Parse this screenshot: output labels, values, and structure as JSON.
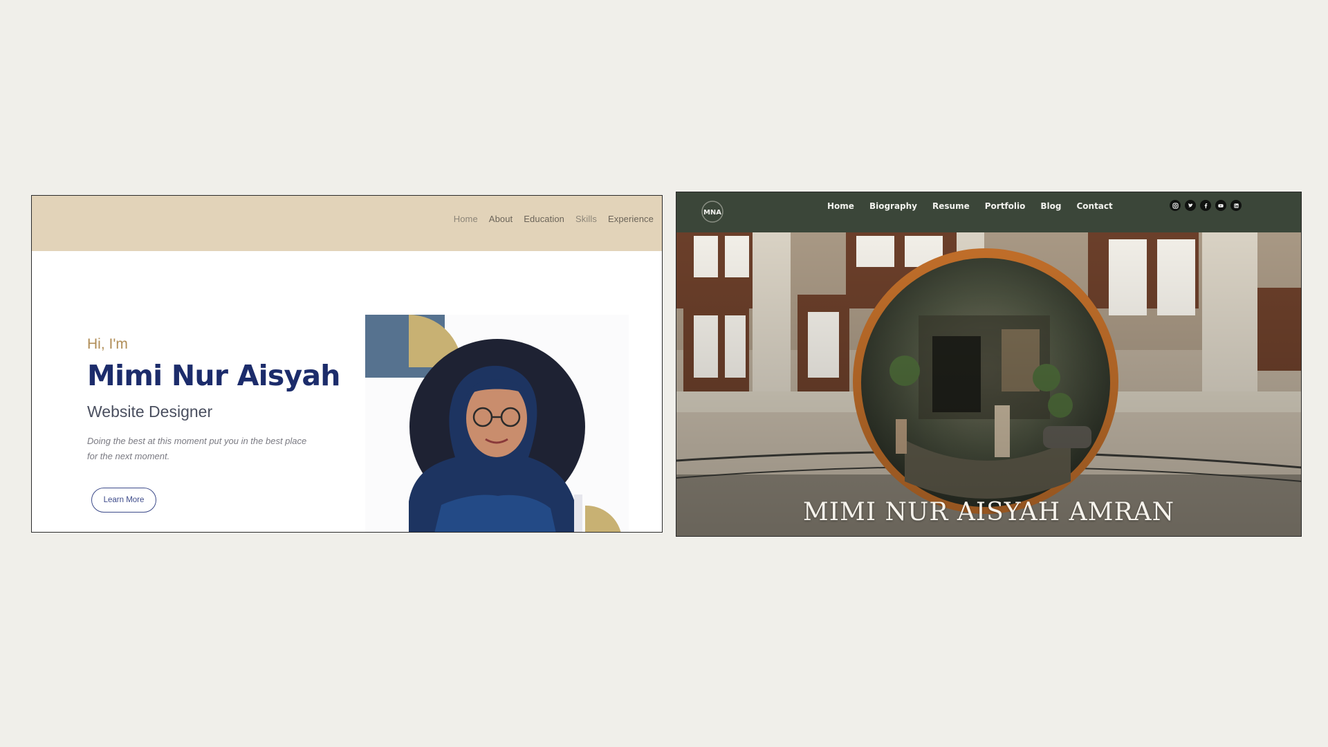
{
  "left_site": {
    "nav": [
      {
        "label": "Home"
      },
      {
        "label": "About"
      },
      {
        "label": "Education"
      },
      {
        "label": "Skills"
      },
      {
        "label": "Experience"
      }
    ],
    "greeting": "Hi, I'm",
    "name": "Mimi Nur Aisyah",
    "role": "Website Designer",
    "tagline": "Doing the best at this moment put you in the best place for the next moment.",
    "button_label": "Learn More",
    "colors": {
      "header_bg": "#e2d3b9",
      "name": "#1c2c6b",
      "greeting": "#b08d57",
      "accent_blue": "#56728f",
      "accent_gold": "#c8b173",
      "photo_circle": "#1e2233"
    }
  },
  "right_site": {
    "logo_text": "MNA",
    "nav": [
      {
        "label": "Home"
      },
      {
        "label": "Biography"
      },
      {
        "label": "Resume"
      },
      {
        "label": "Portfolio"
      },
      {
        "label": "Blog"
      },
      {
        "label": "Contact"
      }
    ],
    "social_icons": [
      "instagram-icon",
      "twitter-icon",
      "facebook-icon",
      "youtube-icon",
      "linkedin-icon"
    ],
    "hero_title": "MIMI NUR AISYAH AMRAN",
    "colors": {
      "header_bg": "#3b4639",
      "nav_text": "#f2f2ee",
      "title_text": "#f6f3ec"
    }
  }
}
